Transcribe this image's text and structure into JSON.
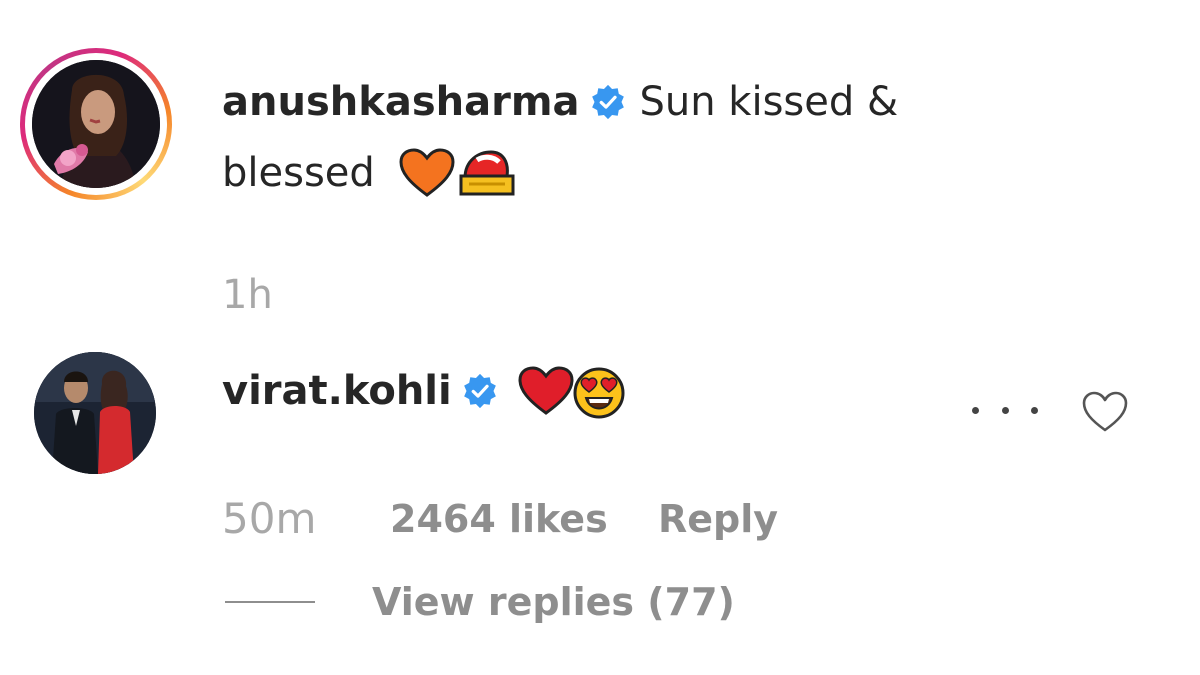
{
  "post": {
    "username": "anushkasharma",
    "caption_line1": "Sun kissed &",
    "caption_line2": "blessed",
    "caption_emojis": [
      "orange-heart-emoji",
      "cap-emoji"
    ],
    "time": "1h"
  },
  "comment": {
    "username": "virat.kohli",
    "emojis": [
      "red-heart-emoji",
      "heart-eyes-emoji"
    ],
    "time": "50m",
    "likes": "2464 likes",
    "reply_label": "Reply",
    "view_replies": "View replies (77)"
  },
  "colors": {
    "verified_blue": "#3897f0",
    "meta_gray": "#8e8e8e",
    "text": "#262626",
    "ring_gradient": [
      "#f58529",
      "#dd2a7b",
      "#feda77"
    ]
  },
  "icons": {
    "verified": "verified-badge-icon",
    "more": "more-options-icon",
    "like": "heart-outline-icon"
  }
}
